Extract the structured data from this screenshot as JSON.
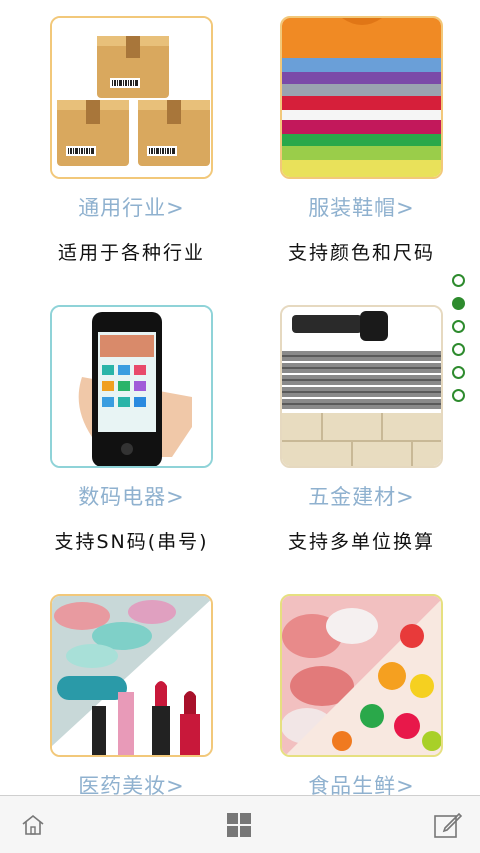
{
  "items": [
    {
      "category": "通用行业>",
      "description": "适用于各种行业",
      "icon": "cardboard-boxes-image"
    },
    {
      "category": "服装鞋帽>",
      "description": "支持颜色和尺码",
      "icon": "folded-shirts-image"
    },
    {
      "category": "数码电器>",
      "description": "支持SN码(串号)",
      "icon": "smartphone-image"
    },
    {
      "category": "五金建材>",
      "description": "支持多单位换算",
      "icon": "bolt-rebar-image"
    },
    {
      "category": "医药美妆>",
      "description": "",
      "icon": "pills-lipstick-image"
    },
    {
      "category": "食品生鲜>",
      "description": "",
      "icon": "meat-candy-image"
    }
  ],
  "pager": {
    "total": 6,
    "active_index": 1
  },
  "tabbar": {
    "home_icon": "home-icon",
    "grid_icon": "grid-icon",
    "edit_icon": "edit-icon"
  },
  "colors": {
    "category_text": "#8fb1cf",
    "pager_green": "#2e8b2e"
  }
}
